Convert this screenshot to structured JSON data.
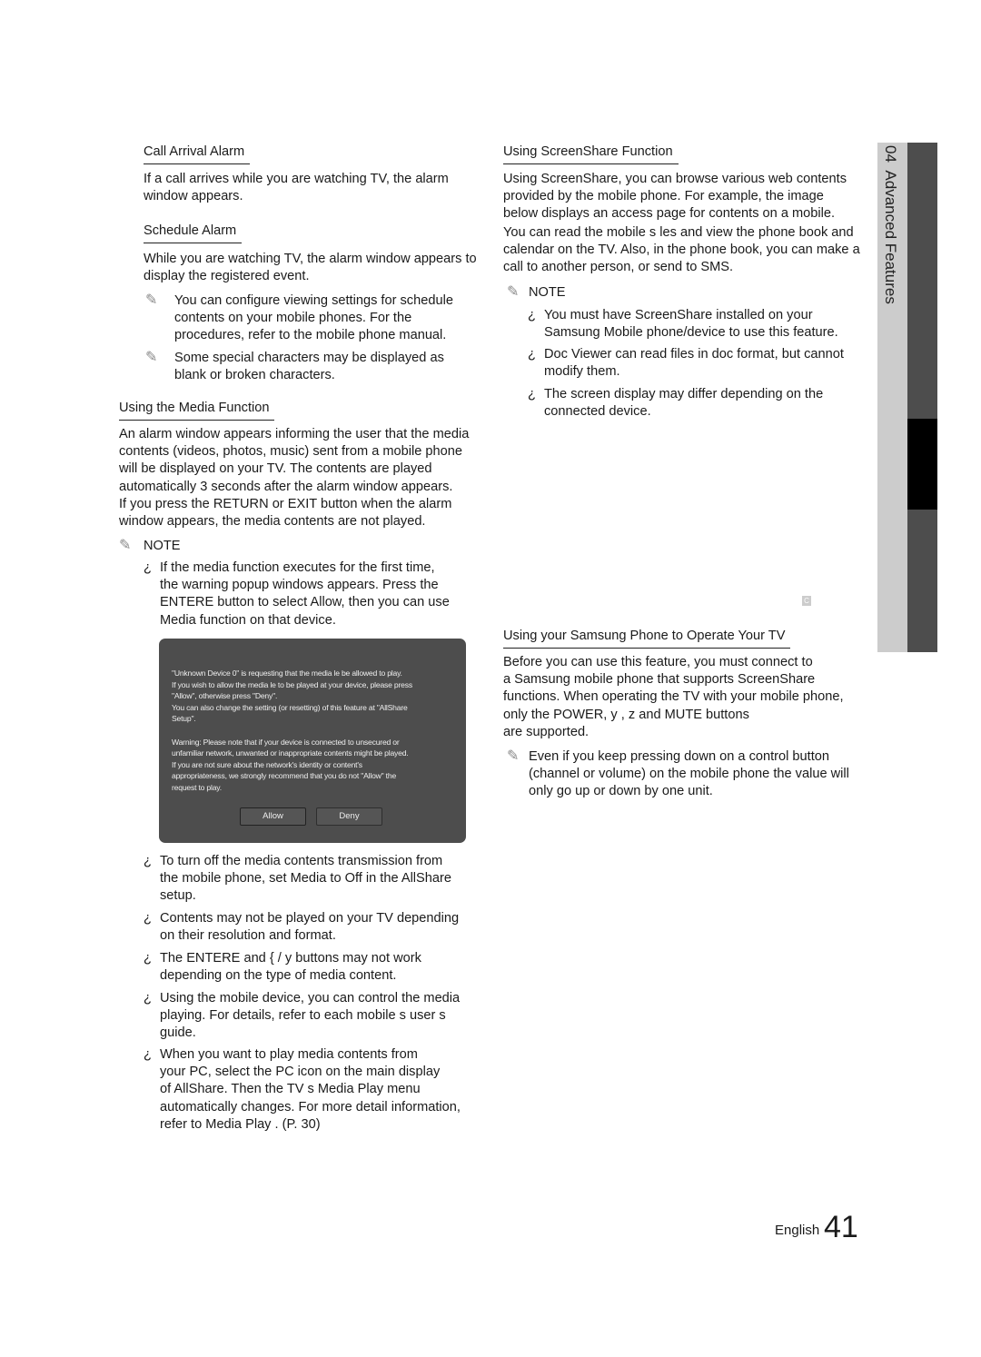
{
  "left": {
    "call_arrival": {
      "heading": "Call Arrival Alarm",
      "body": "If a call arrives while you are watching TV, the alarm\nwindow appears."
    },
    "schedule": {
      "heading": "Schedule Alarm",
      "body": "While you are watching TV, the alarm window appears to\ndisplay the registered event.",
      "notes": [
        "You can configure viewing settings for schedule\ncontents on your mobile phones. For the\nprocedures, refer to the mobile phone manual.",
        "Some special characters may be displayed as\nblank or broken characters."
      ]
    },
    "media": {
      "heading": "Using the Media Function",
      "body": "An alarm window appears informing the user that the media\ncontents (videos, photos, music) sent from a mobile phone\nwill be displayed on your TV. The contents are played\nautomatically 3 seconds after the alarm window appears.\nIf you press the RETURN or EXIT button when the alarm\nwindow appears, the media contents are not played.",
      "note_label": "NOTE",
      "bullets": [
        "If the media function executes for the first time,\nthe warning popup windows appears. Press the\nENTERE   button to select Allow, then you can use\nMedia function on that device.",
        "To turn off the media contents transmission from\nthe mobile phone, set Media to Off in the AllShare\nsetup.",
        "Contents may not be played on your TV depending\non their resolution and format.",
        "The ENTERE    and  {  /  y  buttons may not work\ndepending on the type of media content.",
        "Using the mobile device, you can control the media\nplaying. For details, refer to each mobile s user s\nguide.",
        "When you want to play media contents from\nyour PC, select the PC icon on the main display\nof AllShare. Then the TV s Media Play  menu\nautomatically changes. For more detail information,\nrefer to Media Play . (P. 30)"
      ]
    },
    "popup": {
      "text": "\"Unknown Device 0\" is requesting that the media  le be allowed to play.\nIf you wish to allow the media  le to be played at your device, please press\n\"Allow\", otherwise press \"Deny\".\nYou can also change the setting (or resetting) of this feature at \"AllShare\nSetup\".\n\nWarning: Please note that if your device is connected to unsecured or\nunfamiliar network, unwanted or inappropriate contents might be played.\nIf you are not sure about the network's identity or content's\nappropriateness, we strongly recommend that you do not \"Allow\" the\nrequest to play.",
      "allow": "Allow",
      "deny": "Deny"
    }
  },
  "right": {
    "screenshare": {
      "heading": "Using ScreenShare Function",
      "body1": "Using ScreenShare, you can browse various web contents\nprovided by the mobile phone. For example, the image\nbelow displays an access page for contents on a mobile.",
      "body2": "You can read the mobile s  les and view the phone book and\ncalendar on the TV. Also, in the phone book, you can make a\ncall to another person, or send to SMS.",
      "note_label": "NOTE",
      "bullets": [
        "You must have ScreenShare installed on your\nSamsung Mobile phone/device to use this feature.",
        "Doc Viewer  can read files in doc format, but cannot\nmodify them.",
        "The screen display may differ depending on the\nconnected device."
      ],
      "badge": "C"
    },
    "operate": {
      "heading": "Using your Samsung Phone to Operate Your TV",
      "body": "Before you can use this feature, you must connect to\na Samsung mobile phone that supports ScreenShare\nfunctions. When operating the TV with your mobile phone,\nonly the POWER, y            , z                 and MUTE buttons\nare supported.",
      "note": "Even if you keep pressing down on a control button\n(channel or volume) on the mobile phone the value will\nonly go up or down by one unit."
    }
  },
  "sidebar": {
    "chapter": "04  Advanced Features"
  },
  "footer": {
    "language": "English",
    "page": "41"
  },
  "icons": {
    "note": "pencil-note-icon",
    "bullet": "inverted-question-bullet-icon"
  }
}
